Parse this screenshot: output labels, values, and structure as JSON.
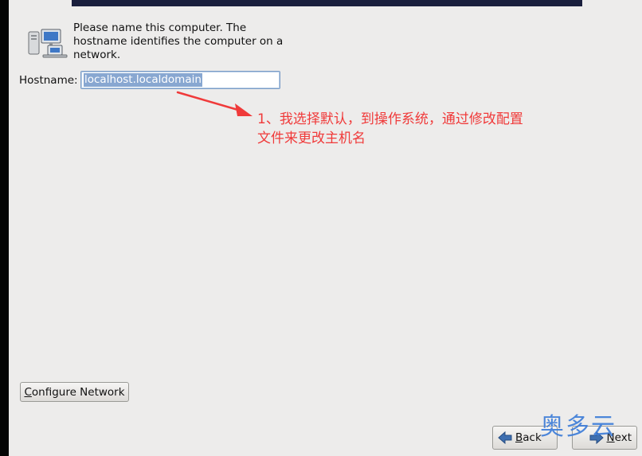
{
  "intro": {
    "text": "Please name this computer.  The hostname identifies the computer on a network."
  },
  "hostname": {
    "label": "Hostname:",
    "value": "localhost.localdomain"
  },
  "annotation": {
    "text": "1、我选择默认，到操作系统，通过修改配置文件来更改主机名",
    "color": "#f03a3a"
  },
  "buttons": {
    "configure_network": {
      "before": "",
      "mnemonic": "C",
      "after": "onfigure Network"
    },
    "back": {
      "before": "",
      "mnemonic": "B",
      "after": "ack"
    },
    "next": {
      "before": "",
      "mnemonic": "N",
      "after": "ext"
    }
  },
  "watermark": {
    "text": "奥多云"
  },
  "icons": {
    "computer": "network-computers-icon",
    "back": "left-arrow-icon",
    "next": "right-arrow-icon"
  },
  "colors": {
    "background": "#edeceb",
    "banner": "#1a1f3d",
    "selection": "#88a7d1",
    "watermark": "#3b7bd8"
  }
}
